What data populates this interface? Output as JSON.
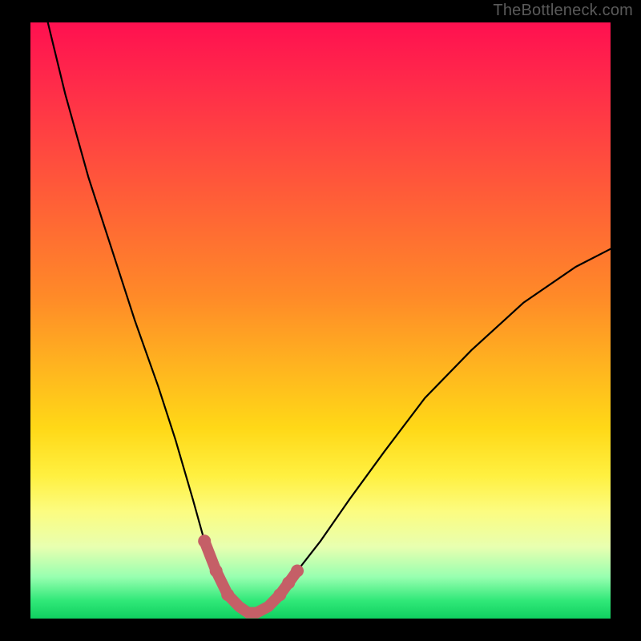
{
  "watermark": "TheBottleneck.com",
  "colors": {
    "frame": "#000000",
    "curve": "#000000",
    "marker": "#c55f67"
  },
  "chart_data": {
    "type": "line",
    "title": "",
    "xlabel": "",
    "ylabel": "",
    "xlim": [
      0,
      100
    ],
    "ylim": [
      0,
      100
    ],
    "grid": false,
    "series": [
      {
        "name": "bottleneck-curve",
        "x": [
          3,
          6,
          10,
          14,
          18,
          22,
          25,
          28,
          30,
          32,
          34,
          36,
          37.5,
          39,
          41,
          43,
          46,
          50,
          55,
          61,
          68,
          76,
          85,
          94,
          100
        ],
        "y": [
          100,
          88,
          74,
          62,
          50,
          39,
          30,
          20,
          13,
          8,
          4,
          2,
          1,
          1,
          2,
          4,
          8,
          13,
          20,
          28,
          37,
          45,
          53,
          59,
          62
        ]
      }
    ],
    "highlight": {
      "name": "optimal-zone",
      "x_range": [
        30,
        46
      ],
      "points": [
        {
          "x": 30,
          "y": 13
        },
        {
          "x": 32,
          "y": 8
        },
        {
          "x": 34,
          "y": 4
        },
        {
          "x": 36,
          "y": 2
        },
        {
          "x": 37.5,
          "y": 1
        },
        {
          "x": 39,
          "y": 1
        },
        {
          "x": 41,
          "y": 2
        },
        {
          "x": 43,
          "y": 4
        },
        {
          "x": 44.5,
          "y": 6
        },
        {
          "x": 46,
          "y": 8
        }
      ]
    }
  }
}
